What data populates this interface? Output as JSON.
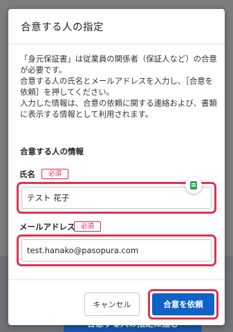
{
  "dialog": {
    "title": "合意する人の指定",
    "description": [
      "「身元保証書」は従業員の関係者（保証人など）の合意が必要です。",
      "合意する人の氏名とメールアドレスを入力し、［合意を依頼］を押してください。",
      "入力した情報は、合意の依頼に関する連絡および、書類に表示する情報として利用されます。"
    ],
    "section_heading": "合意する人の情報",
    "fields": {
      "name": {
        "label": "氏名",
        "required_badge": "必須",
        "value": "テスト 花子"
      },
      "email": {
        "label": "メールアドレス",
        "required_badge": "必須",
        "value": "test.hanako@pasopura.com"
      }
    },
    "footer": {
      "cancel_label": "キャンセル",
      "submit_label": "合意を依頼"
    }
  },
  "background": {
    "button_label": "合意する人の指定に進む"
  },
  "colors": {
    "highlight": "#e0314e",
    "primary": "#0f62c7",
    "required": "#d8284f",
    "autofill_icon": "#2ea44f"
  },
  "icons": {
    "autofill": "password-manager-icon"
  }
}
